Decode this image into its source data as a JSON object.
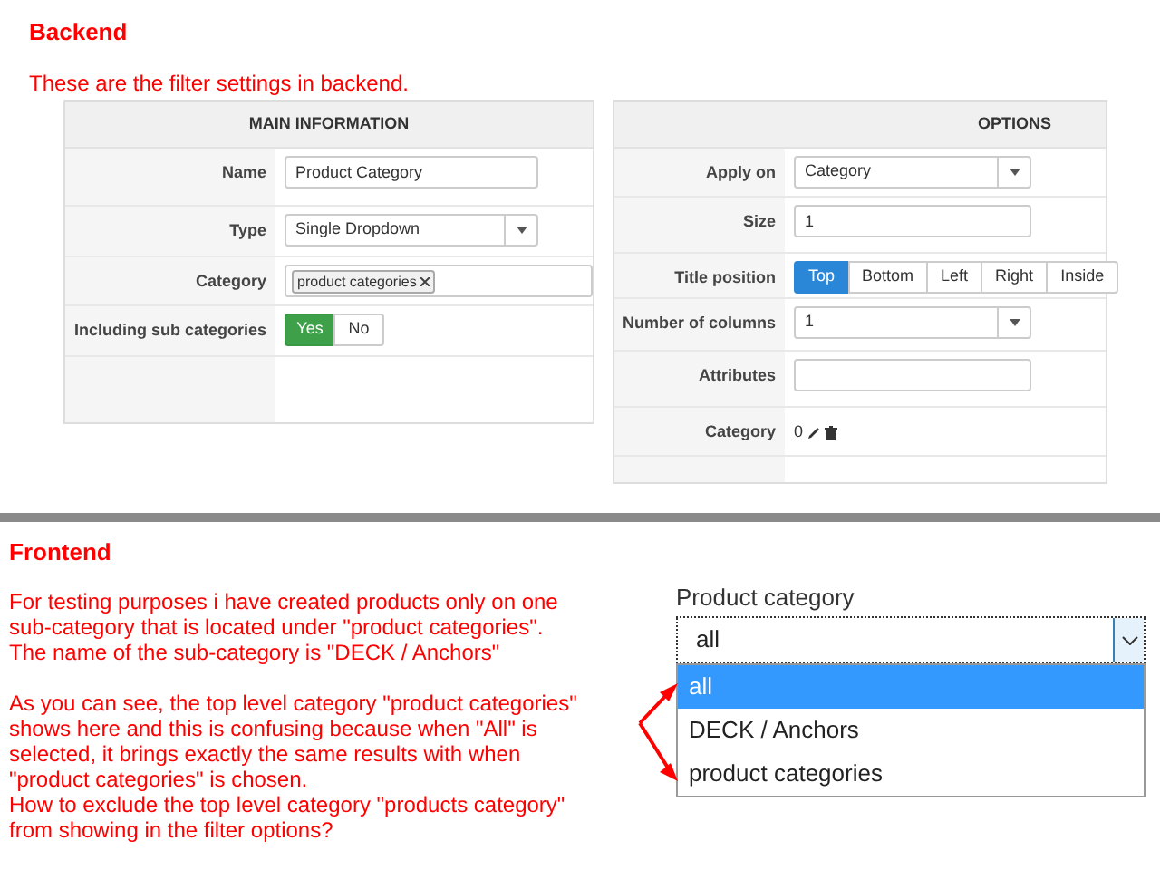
{
  "backend": {
    "heading": "Backend",
    "note": "These are the filter settings in backend.",
    "main_information": {
      "title": "MAIN INFORMATION",
      "fields": [
        {
          "kind": "text",
          "label": "Name",
          "value": "Product Category"
        },
        {
          "kind": "select",
          "label": "Type",
          "value": "Single Dropdown"
        },
        {
          "kind": "tags",
          "label": "Category",
          "tags": [
            "product categories"
          ]
        },
        {
          "kind": "toggle",
          "label": "Including sub categories",
          "options": [
            {
              "label": "Yes",
              "selected": true
            },
            {
              "label": "No",
              "selected": false
            }
          ]
        }
      ]
    },
    "options": {
      "title": "OPTIONS",
      "fields": [
        {
          "kind": "select",
          "label": "Apply on",
          "value": "Category"
        },
        {
          "kind": "text",
          "label": "Size",
          "value": "1"
        },
        {
          "kind": "segmented",
          "label": "Title position",
          "options": [
            {
              "label": "Top",
              "selected": true
            },
            {
              "label": "Bottom",
              "selected": false
            },
            {
              "label": "Left",
              "selected": false
            },
            {
              "label": "Right",
              "selected": false
            },
            {
              "label": "Inside",
              "selected": false
            }
          ]
        },
        {
          "kind": "select",
          "label": "Number of columns",
          "value": "1"
        },
        {
          "kind": "text",
          "label": "Attributes"
        },
        {
          "kind": "actions",
          "label": "Category",
          "value": "0"
        }
      ]
    }
  },
  "frontend": {
    "heading": "Frontend",
    "paragraphs": [
      [
        "For testing purposes i have created products only on one",
        "sub-category that is located under \"product categories\".",
        "The name of the sub-category is \"DECK / Anchors\""
      ],
      [
        "As you can see, the top level category \"product categories\"",
        "shows here and this is confusing because when \"All\" is",
        "selected, it brings exactly the same results with when",
        "\"product categories\" is chosen.",
        "How to exclude the top level category \"products category\"",
        "from showing in the filter options?"
      ]
    ],
    "dropdown": {
      "label": "Product category",
      "value": "all",
      "options": [
        {
          "label": "all",
          "selected": true
        },
        {
          "label": "DECK / Anchors",
          "selected": false
        },
        {
          "label": "product categories",
          "selected": false
        }
      ]
    }
  }
}
